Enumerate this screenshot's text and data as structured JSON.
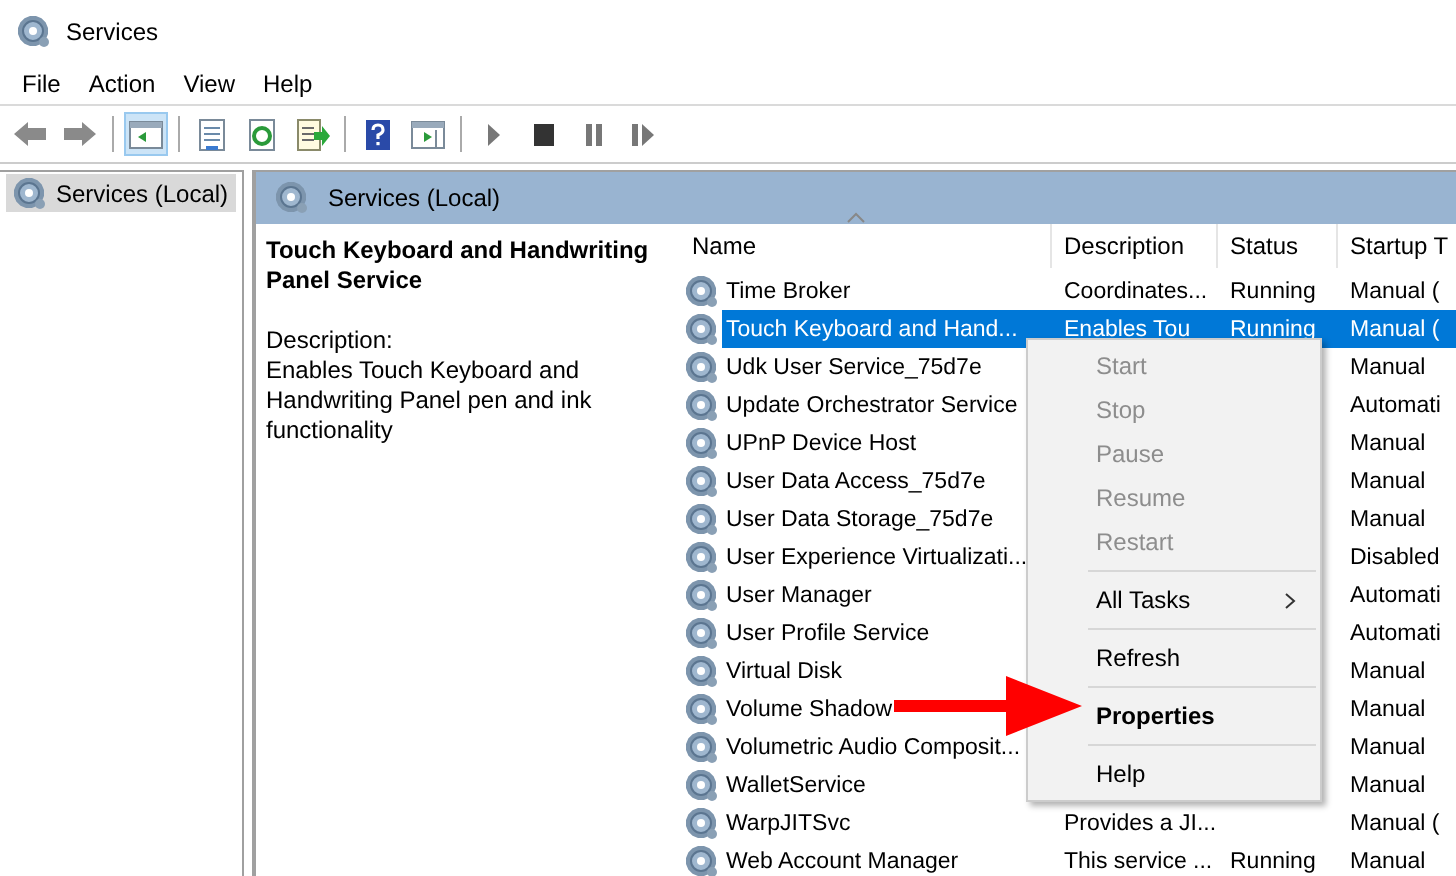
{
  "window": {
    "title": "Services"
  },
  "menu_bar": [
    "File",
    "Action",
    "View",
    "Help"
  ],
  "toolbar": [
    {
      "kind": "back",
      "on": false
    },
    {
      "kind": "forward",
      "on": false
    },
    {
      "kind": "separator"
    },
    {
      "kind": "tree",
      "on": true
    },
    {
      "kind": "separator"
    },
    {
      "kind": "properties",
      "on": false
    },
    {
      "kind": "refresh",
      "on": false
    },
    {
      "kind": "export",
      "on": false
    },
    {
      "kind": "separator"
    },
    {
      "kind": "help",
      "on": false
    },
    {
      "kind": "pane",
      "on": false
    },
    {
      "kind": "separator"
    },
    {
      "kind": "play",
      "on": false
    },
    {
      "kind": "stop",
      "on": false
    },
    {
      "kind": "pause",
      "on": false
    },
    {
      "kind": "resume",
      "on": false
    }
  ],
  "tree": {
    "items": [
      {
        "label": "Services (Local)",
        "selected": true
      }
    ]
  },
  "panel": {
    "title": "Services (Local)",
    "service_name": "Touch Keyboard and Handwriting Panel Service",
    "description_label": "Description:",
    "description": "Enables Touch Keyboard and Handwriting Panel pen and ink functionality"
  },
  "table": {
    "columns": [
      "Name",
      "Description",
      "Status",
      "Startup T"
    ],
    "rows": [
      {
        "name": "Time Broker",
        "description": "Coordinates...",
        "status": "Running",
        "startup": "Manual (",
        "selected": false
      },
      {
        "name": "Touch Keyboard and Hand...",
        "description": "Enables Tou",
        "status": "Running",
        "startup": "Manual (",
        "selected": true
      },
      {
        "name": "Udk User Service_75d7e",
        "startup": "Manual",
        "selected": false
      },
      {
        "name": "Update Orchestrator Service",
        "startup": "Automati",
        "selected": false
      },
      {
        "name": "UPnP Device Host",
        "startup": "Manual",
        "selected": false
      },
      {
        "name": "User Data Access_75d7e",
        "startup": "Manual",
        "selected": false
      },
      {
        "name": "User Data Storage_75d7e",
        "startup": "Manual",
        "selected": false
      },
      {
        "name": "User Experience Virtualizati...",
        "startup": "Disabled",
        "selected": false
      },
      {
        "name": "User Manager",
        "startup": "Automati",
        "selected": false
      },
      {
        "name": "User Profile Service",
        "startup": "Automati",
        "selected": false
      },
      {
        "name": "Virtual Disk",
        "startup": "Manual",
        "selected": false
      },
      {
        "name": "Volume Shadow",
        "startup": "Manual",
        "selected": false
      },
      {
        "name": "Volumetric Audio Composit...",
        "startup": "Manual",
        "selected": false
      },
      {
        "name": "WalletService",
        "startup": "Manual",
        "selected": false
      },
      {
        "name": "WarpJITSvc",
        "description": "Provides a JI...",
        "startup": "Manual (",
        "selected": false
      },
      {
        "name": "Web Account Manager",
        "description": "This service ...",
        "status": "Running",
        "startup": "Manual",
        "selected": false
      }
    ]
  },
  "context_menu": [
    {
      "kind": "item",
      "label": "Start",
      "disabled": true
    },
    {
      "kind": "item",
      "label": "Stop",
      "disabled": true
    },
    {
      "kind": "item",
      "label": "Pause",
      "disabled": true
    },
    {
      "kind": "item",
      "label": "Resume",
      "disabled": true
    },
    {
      "kind": "item",
      "label": "Restart",
      "disabled": true
    },
    {
      "kind": "separator"
    },
    {
      "kind": "submenu",
      "label": "All Tasks",
      "disabled": false
    },
    {
      "kind": "separator"
    },
    {
      "kind": "item",
      "label": "Refresh",
      "disabled": false
    },
    {
      "kind": "separator"
    },
    {
      "kind": "default",
      "label": "Properties",
      "disabled": false
    },
    {
      "kind": "separator"
    },
    {
      "kind": "item",
      "label": "Help",
      "disabled": false
    }
  ]
}
